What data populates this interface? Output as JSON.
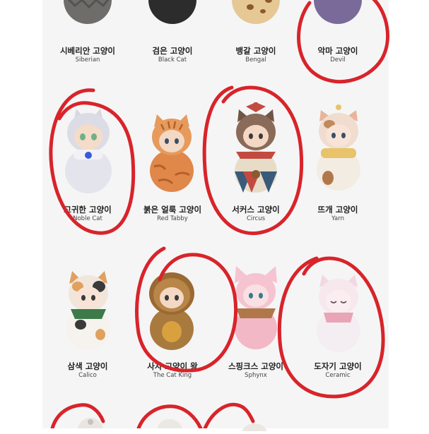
{
  "cells": [
    {
      "ko": "시베리안 고양이",
      "en": "Siberian",
      "body": "#6f6d6a",
      "head": "#5a5856",
      "accent": "#8a8784"
    },
    {
      "ko": "검은 고양이",
      "en": "Black Cat",
      "body": "#2c2c2c",
      "head": "#252525",
      "accent": "#d4b04a"
    },
    {
      "ko": "뱅갈 고양이",
      "en": "Bengal",
      "body": "#e6c894",
      "head": "#d9b77e",
      "accent": "#8b5a2b"
    },
    {
      "ko": "악마 고양이",
      "en": "Devil",
      "body": "#7a6a9a",
      "head": "#6b5b8a",
      "accent": "#4a3b66"
    },
    {
      "ko": "고귀한 고양이",
      "en": "Noble Cat",
      "body": "#e8e8ee",
      "head": "#dcdce6",
      "accent": "#3a5bd8"
    },
    {
      "ko": "붉은 얼룩 고양이",
      "en": "Red Tabby",
      "body": "#e0874a",
      "head": "#e69a5c",
      "accent": "#b5602a"
    },
    {
      "ko": "서커스 고양이",
      "en": "Circus",
      "body": "#d9cfc0",
      "head": "#8a6a58",
      "accent": "#c24a40"
    },
    {
      "ko": "뜨개 고양이",
      "en": "Yarn",
      "body": "#f3ece2",
      "head": "#f0ddd0",
      "accent": "#e8c36a"
    },
    {
      "ko": "삼색 고양이",
      "en": "Calico",
      "body": "#f6f2ee",
      "head": "#f1e6dc",
      "accent": "#3d7a4a"
    },
    {
      "ko": "사자 고양이 왕",
      "en": "The Cat King",
      "body": "#a97a3e",
      "head": "#b78648",
      "accent": "#7a5428"
    },
    {
      "ko": "스핑크스 고양이",
      "en": "Sphynx",
      "body": "#f2b8c6",
      "head": "#f5c4d0",
      "accent": "#b0784a"
    },
    {
      "ko": "도자기 고양이",
      "en": "Ceramic",
      "body": "#f4eef2",
      "head": "#f7e8ee",
      "accent": "#e9a4b6"
    }
  ],
  "colors": {
    "annotation": "#d8242a",
    "sheet": "#f5f5f6"
  }
}
